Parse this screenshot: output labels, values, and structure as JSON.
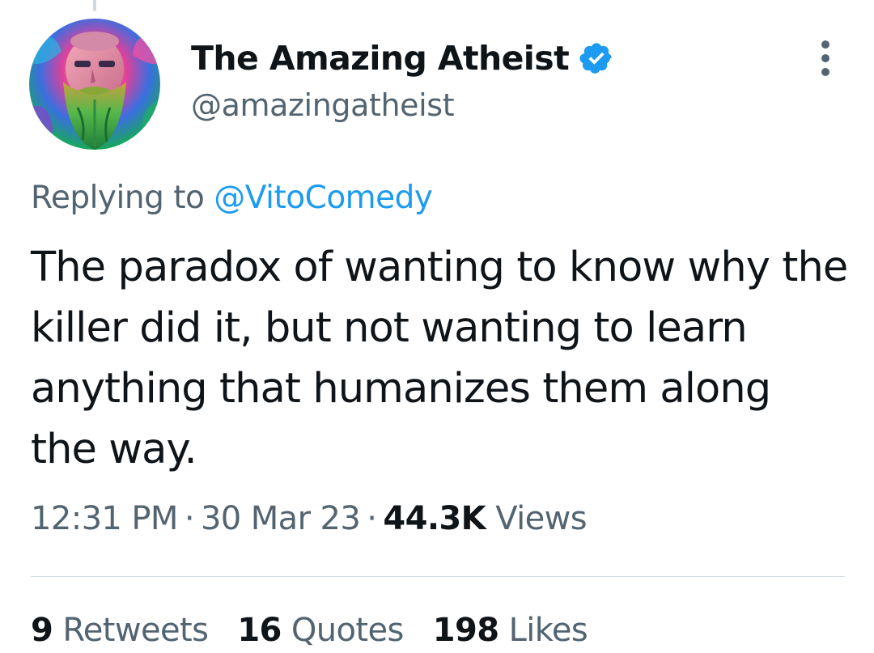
{
  "tweet": {
    "author": {
      "name": "The Amazing Atheist",
      "handle": "@amazingatheist",
      "avatar_icon": "bearded-man-avatar",
      "verified": true,
      "verified_color": "#1d9bf0"
    },
    "reply_context": {
      "prefix": "Replying to",
      "handle": "@VitoComedy"
    },
    "text": "The paradox of wanting to know why the killer did it, but not wanting to learn anything that humanizes them along the way.",
    "meta": {
      "time": "12:31 PM",
      "separator": "·",
      "date": "30 Mar 23",
      "views_count": "44.3K",
      "views_label": "Views"
    },
    "stats": {
      "retweets_count": "9",
      "retweets_label": "Retweets",
      "quotes_count": "16",
      "quotes_label": "Quotes",
      "likes_count": "198",
      "likes_label": "Likes"
    }
  },
  "icons": {
    "more": "more-options-icon",
    "verified": "verified-badge-icon"
  },
  "colors": {
    "accent": "#1d9bf0",
    "text_primary": "#0f1419",
    "text_secondary": "#536471"
  }
}
